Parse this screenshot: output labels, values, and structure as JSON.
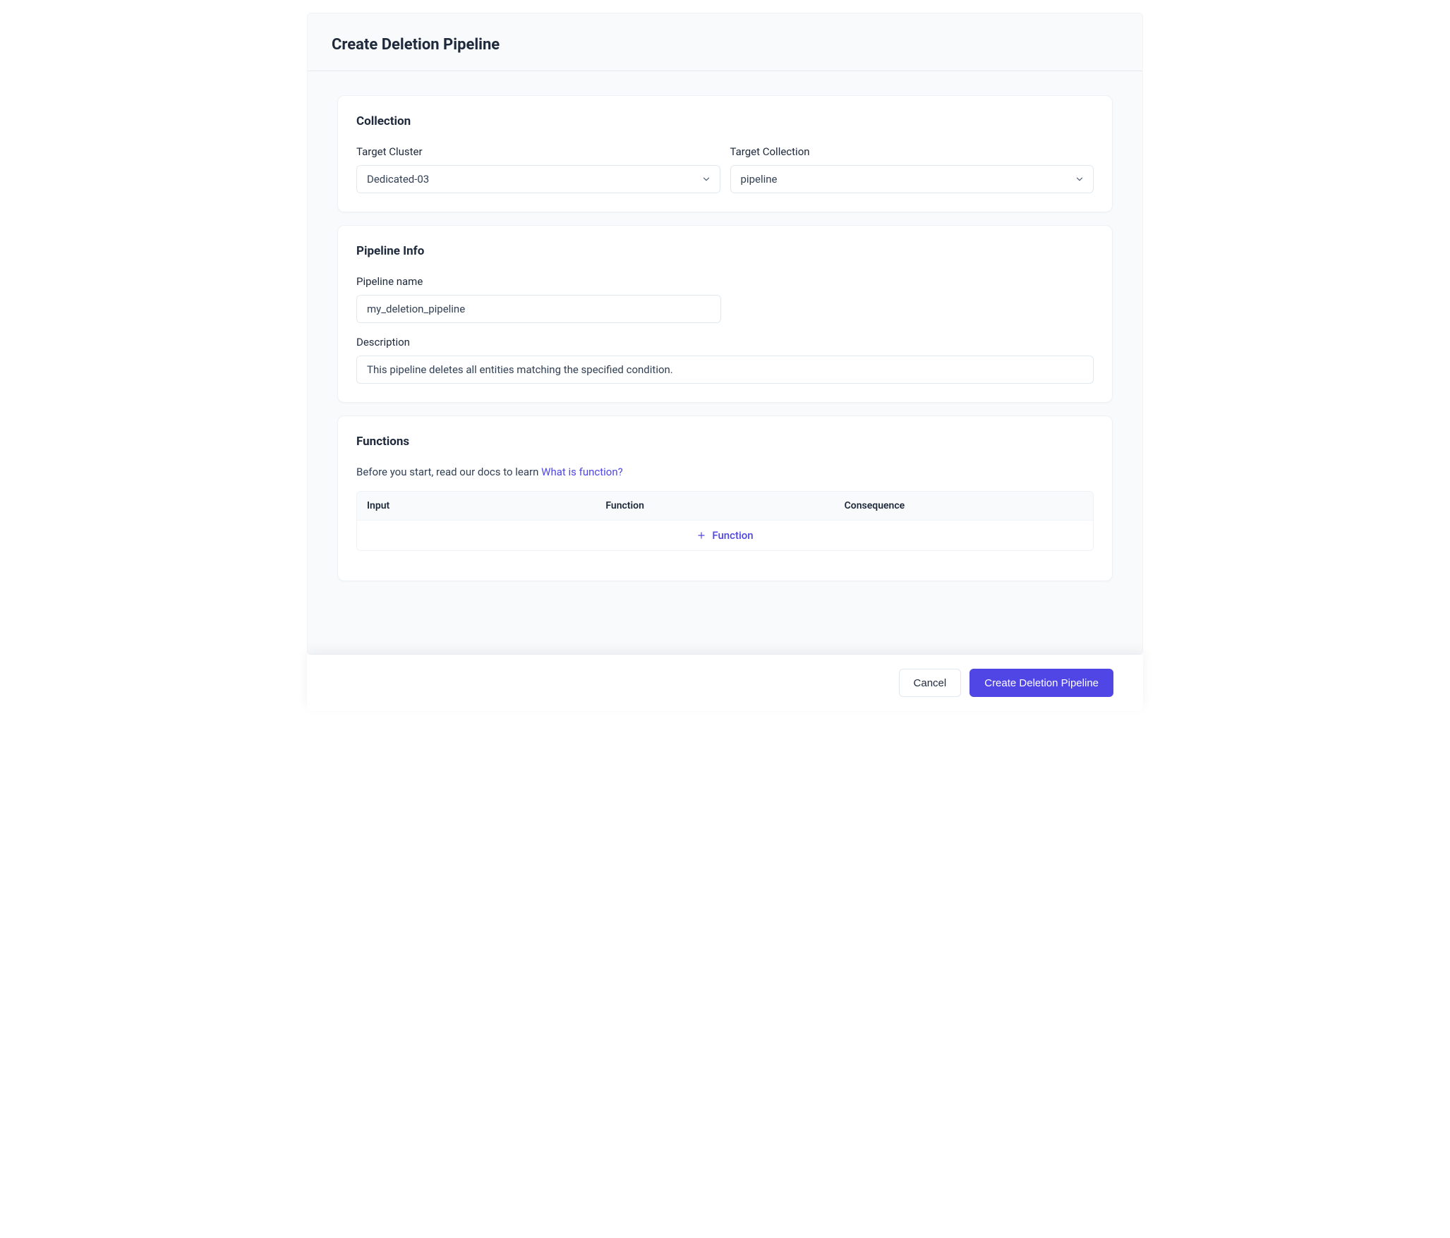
{
  "header": {
    "title": "Create Deletion Pipeline"
  },
  "collection": {
    "title": "Collection",
    "target_cluster_label": "Target Cluster",
    "target_cluster_value": "Dedicated-03",
    "target_collection_label": "Target Collection",
    "target_collection_value": "pipeline"
  },
  "pipeline_info": {
    "title": "Pipeline Info",
    "name_label": "Pipeline name",
    "name_value": "my_deletion_pipeline",
    "description_label": "Description",
    "description_value": "This pipeline deletes all entities matching the specified condition."
  },
  "functions": {
    "title": "Functions",
    "hint_prefix": "Before you start, read our docs to learn ",
    "hint_link": "What is function?",
    "columns": {
      "input": "Input",
      "function": "Function",
      "consequence": "Consequence"
    },
    "add_label": "Function"
  },
  "footer": {
    "cancel": "Cancel",
    "submit": "Create Deletion Pipeline"
  }
}
